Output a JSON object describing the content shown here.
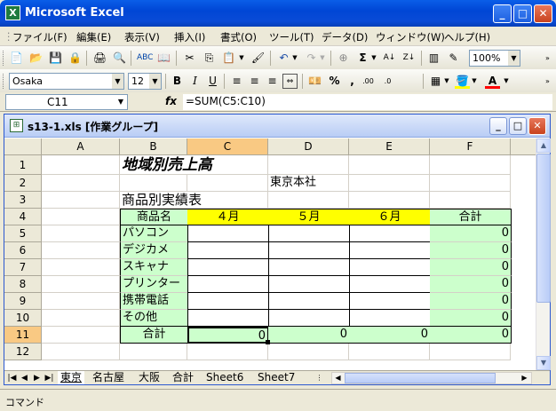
{
  "app": {
    "title": "Microsoft Excel",
    "icon": "X"
  },
  "menu": [
    "ファイル(F)",
    "編集(E)",
    "表示(V)",
    "挿入(I)",
    "書式(O)",
    "ツール(T)",
    "データ(D)",
    "ウィンドウ(W)",
    "ヘルプ(H)"
  ],
  "toolbar": {
    "zoom": "100%"
  },
  "format_toolbar": {
    "font": "Osaka",
    "size": "12"
  },
  "formula_bar": {
    "name_box": "C11",
    "fx": "fx",
    "formula": "=SUM(C5:C10)"
  },
  "workbook": {
    "title": "s13-1.xls [作業グループ]"
  },
  "columns": [
    "A",
    "B",
    "C",
    "D",
    "E",
    "F"
  ],
  "selected_column": "C",
  "rows": [
    "1",
    "2",
    "3",
    "4",
    "5",
    "6",
    "7",
    "8",
    "9",
    "10",
    "11",
    "12"
  ],
  "selected_row": "11",
  "cells": {
    "title": "地域別売上高",
    "branch": "東京本社",
    "subtitle": "商品別実績表",
    "header_product": "商品名",
    "header_apr": "４月",
    "header_may": "５月",
    "header_jun": "６月",
    "header_total": "合計",
    "products": [
      "パソコン",
      "デジカメ",
      "スキャナ",
      "プリンター",
      "携帯電話",
      "その他"
    ],
    "row_totals": [
      "0",
      "0",
      "0",
      "0",
      "0",
      "0"
    ],
    "total_label": "合計",
    "sum_apr": "0",
    "sum_may": "0",
    "sum_jun": "0",
    "sum_total": "0"
  },
  "sheet_tabs": [
    "東京",
    "名古屋",
    "大阪",
    "合計",
    "Sheet6",
    "Sheet7"
  ],
  "active_tab": "東京",
  "status": "コマンド",
  "colors": {
    "header_fill": "#ffff00",
    "green_fill": "#ccffcc",
    "selected_header": "#f9c983",
    "title_bar": "#0a5ee8"
  }
}
